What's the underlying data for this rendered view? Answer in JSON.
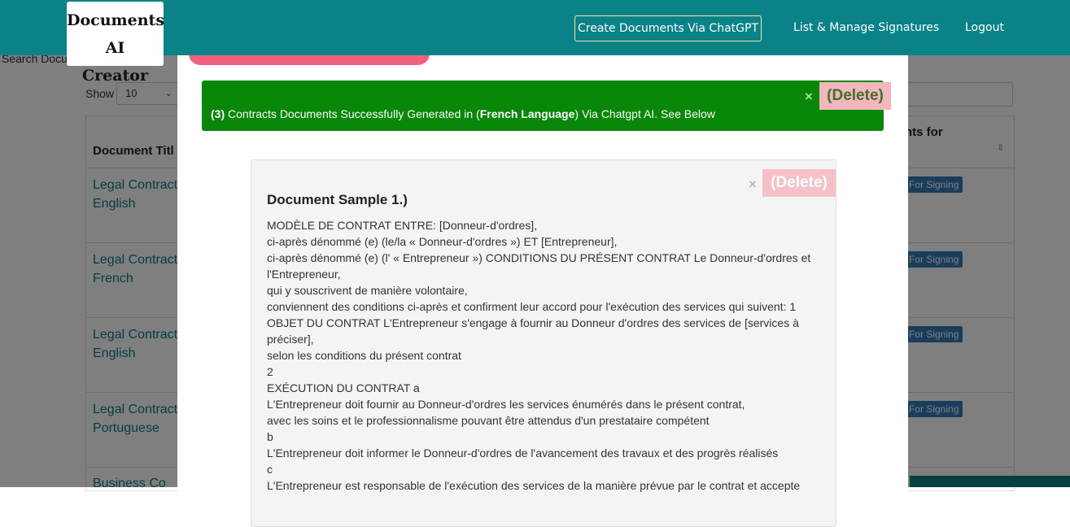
{
  "header": {
    "logo_line1": "Documents AI",
    "logo_line2": "Creator",
    "nav": {
      "create": "Create Documents Via ChatGPT",
      "signatures": "List & Manage Signatures",
      "logout": "Logout"
    }
  },
  "background": {
    "search_label": "Search Docu",
    "show_label": "Show",
    "show_value": "10",
    "col_title": "Document Titl",
    "col_right": "nts for",
    "rows": [
      {
        "line1": "Legal Contract",
        "line2": "English",
        "button": "For Signing"
      },
      {
        "line1": "Legal Contract",
        "line2": "French",
        "button": "For Signing"
      },
      {
        "line1": "Legal Contract",
        "line2": "English",
        "button": "For Signing"
      },
      {
        "line1": "Legal Contract",
        "line2": "Portuguese",
        "button": "For Signing"
      },
      {
        "line1": "Business Co",
        "line2": "",
        "button": ""
      }
    ]
  },
  "alert": {
    "count": "(3)",
    "text_a": " Contracts Documents Successfully Generated in (",
    "language": "French Language",
    "text_b": ") Via Chatgpt AI. See Below",
    "close": "×",
    "delete": "(Delete)"
  },
  "sample": {
    "title": "Document Sample 1.)",
    "close": "×",
    "delete": "(Delete)",
    "lines": [
      "MODÈLE DE CONTRAT ENTRE: [Donneur-d'ordres],",
      "ci-après dénommé (e) (le/la « Donneur-d'ordres ») ET [Entrepreneur],",
      "ci-après dénommé (e) (l' « Entrepreneur ») CONDITIONS DU PRÉSENT CONTRAT Le Donneur-d'ordres et l'Entrepreneur,",
      "qui y souscrivent de manière volontaire,",
      "conviennent des conditions ci-après et confirment leur accord pour l'exécution des services qui suivent: 1",
      "OBJET DU CONTRAT L'Entrepreneur s'engage à fournir au Donneur d'ordres des services de [services à préciser],",
      "selon les conditions du présent contrat",
      "2",
      "EXÉCUTION DU CONTRAT a",
      "L'Entrepreneur doit fournir au Donneur-d'ordres les services énumérés dans le présent contrat,",
      "avec les soins et le professionnalisme pouvant être attendus d'un prestataire compétent",
      "b",
      "L'Entrepreneur doit informer le Donneur-d'ordres de l'avancement des travaux et des progrès réalisés",
      "c",
      "L'Entrepreneur est responsable de l'exécution des services de la manière prévue par le contrat et accepte"
    ]
  }
}
